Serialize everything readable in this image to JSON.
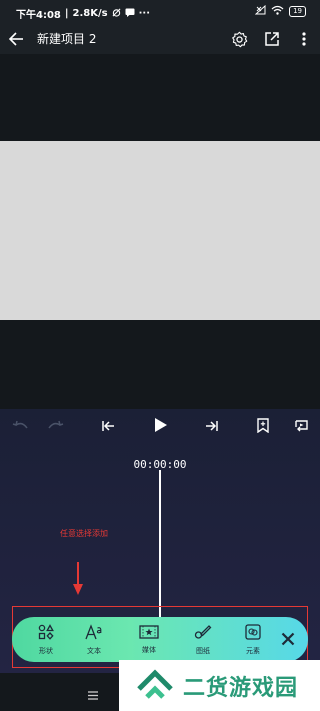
{
  "status_bar": {
    "time": "下午4:08",
    "network_speed": "2.8K/s",
    "overflow": "···",
    "battery": "19"
  },
  "app_bar": {
    "title": "新建项目 2"
  },
  "player": {
    "timecode": "00:00:00"
  },
  "annotation": {
    "text": "任意选择添加"
  },
  "toolbar": {
    "items": [
      {
        "label": "形状",
        "icon": "shapes-icon"
      },
      {
        "label": "文本",
        "icon": "text-icon"
      },
      {
        "label": "媒体",
        "icon": "media-icon"
      },
      {
        "label": "图纸",
        "icon": "drawing-icon"
      },
      {
        "label": "元素",
        "icon": "element-icon"
      }
    ]
  },
  "watermark": {
    "text": "二货游戏园"
  },
  "colors": {
    "toolbar_gradient_start": "#4fd8a0",
    "toolbar_gradient_end": "#57d8e8",
    "annotation_red": "#e53935",
    "watermark_green": "#2a9a78"
  }
}
